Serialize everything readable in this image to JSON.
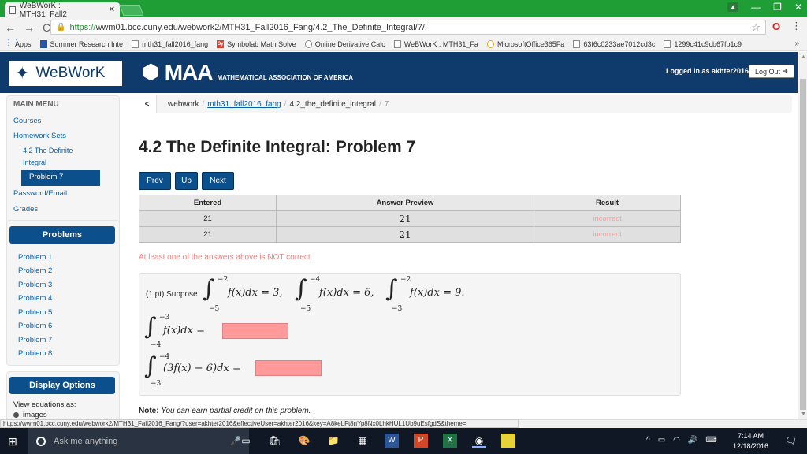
{
  "browser": {
    "tab_title": "WeBWorK : MTH31_Fall2",
    "url_https": "https://",
    "url_rest": "wwm01.bcc.cuny.edu/webwork2/MTH31_Fall2016_Fang/4.2_The_Definite_Integral/7/",
    "bookmarks": [
      {
        "label": "Apps",
        "icon": "apps-grid-icon"
      },
      {
        "label": "Summer Research Inte",
        "icon": "page-icon"
      },
      {
        "label": "mth31_fall2016_fang",
        "icon": "page-icon"
      },
      {
        "label": "Symbolab Math Solve",
        "icon": "symbolab-icon"
      },
      {
        "label": "Online Derivative Calc",
        "icon": "page-icon"
      },
      {
        "label": "WeBWorK : MTH31_Fa",
        "icon": "page-icon"
      },
      {
        "label": "MicrosoftOffice365Fa",
        "icon": "office-icon"
      },
      {
        "label": "63f6c0233ae7012cd3c",
        "icon": "page-icon"
      },
      {
        "label": "1299c41c9cb67fb1c9",
        "icon": "page-icon"
      }
    ],
    "more": "»",
    "status_url": "https://wwm01.bcc.cuny.edu/webwork2/MTH31_Fall2016_Fang/?user=akhter2016&effectiveUser=akhter2016&key=A8keLFt8nYp8Nx0LhkHUL1Ub9uEsfgdS&theme="
  },
  "header": {
    "logo_text": "WeBWorK",
    "maa_big": "MAA",
    "maa_small": "MATHEMATICAL ASSOCIATION OF AMERICA",
    "logged_in": "Logged in as akhter2016.",
    "logout": "Log Out"
  },
  "sidebar": {
    "main_menu": "MAIN MENU",
    "courses": "Courses",
    "homework_sets": "Homework Sets",
    "set_line1": "4.2 The Definite",
    "set_line2": "Integral",
    "active_problem": "Problem 7",
    "password": "Password/Email",
    "grades": "Grades",
    "problems_btn": "Problems",
    "problems": [
      "Problem 1",
      "Problem 2",
      "Problem 3",
      "Problem 4",
      "Problem 5",
      "Problem 6",
      "Problem 7",
      "Problem 8"
    ],
    "display_options": "Display Options",
    "view_eq": "View equations as:",
    "images": "images"
  },
  "breadcrumb": {
    "c1": "webwork",
    "c2": "mth31_fall2016_fang",
    "c3": "4.2_the_definite_integral",
    "c4": "7",
    "sep": "/"
  },
  "main": {
    "title": "4.2 The Definite Integral: Problem 7",
    "prev": "Prev",
    "up": "Up",
    "next": "Next",
    "table_headers": [
      "Entered",
      "Answer Preview",
      "Result"
    ],
    "rows": [
      {
        "entered": "21",
        "preview": "21",
        "result": "incorrect"
      },
      {
        "entered": "21",
        "preview": "21",
        "result": "incorrect"
      }
    ],
    "warning": "At least one of the answers above is NOT correct.",
    "pts": "(1 pt) Suppose",
    "note_label": "Note:",
    "note_text": "You can earn partial credit on this problem."
  },
  "taskbar": {
    "search": "Ask me anything",
    "time": "7:14 AM",
    "date": "12/18/2016"
  },
  "colors": {
    "webwork_blue": "#0f3a6c",
    "button_blue": "#0b4f8c",
    "incorrect": "#f7a0a0",
    "answer_box": "#ff9a9a"
  }
}
